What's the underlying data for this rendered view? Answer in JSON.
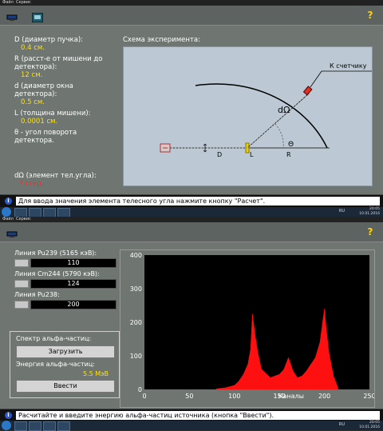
{
  "top": {
    "menu": [
      "Файл",
      "Сервис"
    ],
    "params": {
      "D_label": "D (диаметр пучка):",
      "D_value": "0.4 см.",
      "R_label": "R (расст-е от мишени до детектора):",
      "R_value": "12 см.",
      "d_label": "d (диаметр окна детектора):",
      "d_value": "0.5 см.",
      "L_label": "L (толщина мишени):",
      "L_value": "0.0001 см.",
      "theta_label": "θ - угол поворота детектора.",
      "omega_label": "dΩ (элемент тел.угла):",
      "omega_value": "? стер."
    },
    "diagram": {
      "title": "Схема эксперимента:",
      "counter_label": "К счетчику",
      "d_omega": "dΩ",
      "theta": "Θ",
      "D": "D",
      "L": "L",
      "R": "R"
    },
    "status": "Для ввода значения элемента телесного угла нажмите кнопку \"Расчет\"."
  },
  "taskbar1": {
    "lang": "RU",
    "time": "20:05",
    "date": "10.01.2016"
  },
  "bottom": {
    "menu": [
      "Файл",
      "Сервис"
    ],
    "lines": [
      {
        "label": "Линия Pu239 (5165 кэВ):",
        "value": "110"
      },
      {
        "label": "Линия Cm244 (5790 кэВ):",
        "value": "124"
      },
      {
        "label": "Линия Pu238:",
        "value": "200"
      }
    ],
    "spectrum_label": "Спектр альфа-частиц:",
    "load_button": "Загрузить",
    "energy_label": "Энергия альфа-частиц:",
    "energy_value": "5.5 МэВ",
    "enter_button": "Ввести",
    "status": "Расчитайте и введите энергию альфа-частиц источника (кнопка \"Ввести\")."
  },
  "taskbar2": {
    "lang": "RU",
    "time": "20:05",
    "date": "10.01.2016"
  },
  "colors": {
    "panel": "#6f7672",
    "diagram_bg": "#bcc9d4",
    "spectrum": "#ff1010",
    "status_bg": "#111111"
  },
  "chart_data": {
    "type": "area",
    "xlabel": "Каналы",
    "ylabel": "",
    "xlim": [
      0,
      250
    ],
    "ylim": [
      0,
      400
    ],
    "x_ticks": [
      0,
      50,
      100,
      150,
      200,
      250
    ],
    "y_ticks": [
      0,
      100,
      200,
      300,
      400
    ],
    "x": [
      80,
      90,
      100,
      105,
      110,
      115,
      118,
      120,
      123,
      126,
      130,
      140,
      150,
      155,
      160,
      165,
      170,
      175,
      180,
      185,
      190,
      195,
      198,
      200,
      202,
      205,
      210,
      215
    ],
    "values": [
      2,
      5,
      12,
      25,
      45,
      75,
      120,
      225,
      160,
      110,
      60,
      35,
      45,
      60,
      95,
      55,
      35,
      40,
      55,
      75,
      95,
      140,
      200,
      240,
      180,
      110,
      40,
      5
    ]
  }
}
